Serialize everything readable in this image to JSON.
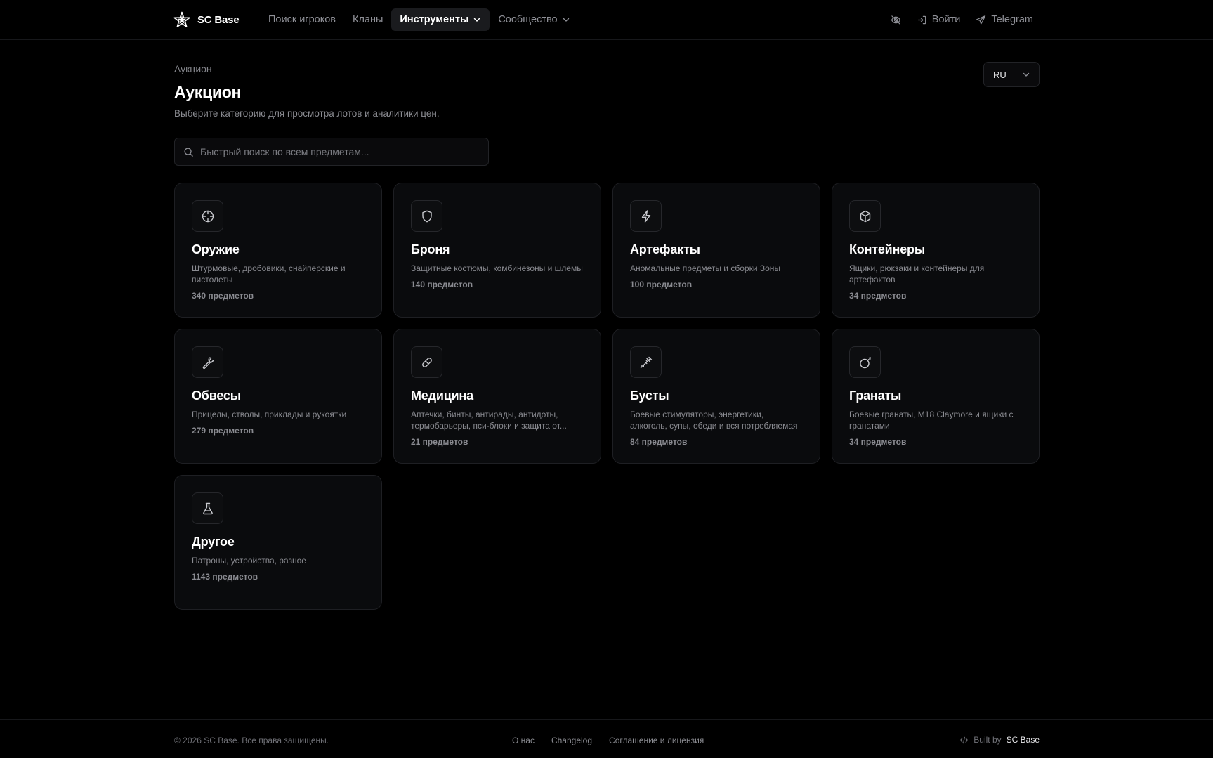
{
  "nav": {
    "brand": "SC Base",
    "links": [
      {
        "label": "Поиск игроков"
      },
      {
        "label": "Кланы"
      },
      {
        "label": "Инструменты"
      },
      {
        "label": "Сообщество"
      }
    ],
    "login": "Войти",
    "telegram": "Telegram"
  },
  "header": {
    "breadcrumb": "Аукцион",
    "title": "Аукцион",
    "subtitle": "Выберите категорию для просмотра лотов и аналитики цен.",
    "language": "RU"
  },
  "search": {
    "placeholder": "Быстрый поиск по всем предметам...",
    "value": ""
  },
  "categories": [
    {
      "title": "Оружие",
      "description": "Штурмовые, дробовики, снайперские и пистолеты",
      "count": "340 предметов",
      "icon": "crosshair-icon"
    },
    {
      "title": "Броня",
      "description": "Защитные костюмы, комбинезоны и шлемы",
      "count": "140 предметов",
      "icon": "shield-icon"
    },
    {
      "title": "Артефакты",
      "description": "Аномальные предметы и сборки Зоны",
      "count": "100 предметов",
      "icon": "lightning-icon"
    },
    {
      "title": "Контейнеры",
      "description": "Ящики, рюкзаки и контейнеры для артефактов",
      "count": "34 предметов",
      "icon": "box-icon"
    },
    {
      "title": "Обвесы",
      "description": "Прицелы, стволы, приклады и рукоятки",
      "count": "279 предметов",
      "icon": "wrench-icon"
    },
    {
      "title": "Медицина",
      "description": "Аптечки, бинты, антирады, антидоты, термобарьеры, пси-блоки и защита от...",
      "count": "21 предметов",
      "icon": "pill-icon"
    },
    {
      "title": "Бусты",
      "description": "Боевые стимуляторы, энергетики, алкоголь, супы, обеди и вся потребляемая еда/...",
      "count": "84 предметов",
      "icon": "syringe-icon"
    },
    {
      "title": "Гранаты",
      "description": "Боевые гранаты, M18 Claymore и ящики с гранатами",
      "count": "34 предметов",
      "icon": "bomb-icon"
    },
    {
      "title": "Другое",
      "description": "Патроны, устройства, разное",
      "count": "1143 предметов",
      "icon": "flask-icon"
    }
  ],
  "footer": {
    "copyright": "© 2026 SC Base. Все права защищены.",
    "links": [
      {
        "label": "О нас"
      },
      {
        "label": "Changelog"
      },
      {
        "label": "Соглашение и лицензия"
      }
    ],
    "built_by_label": "Built by",
    "built_by_name": "SC Base"
  },
  "colors": {
    "background": "#000000",
    "card": "#0a0b0d",
    "border": "#1e1f23",
    "text": "#ffffff",
    "muted": "#8a8b91"
  }
}
